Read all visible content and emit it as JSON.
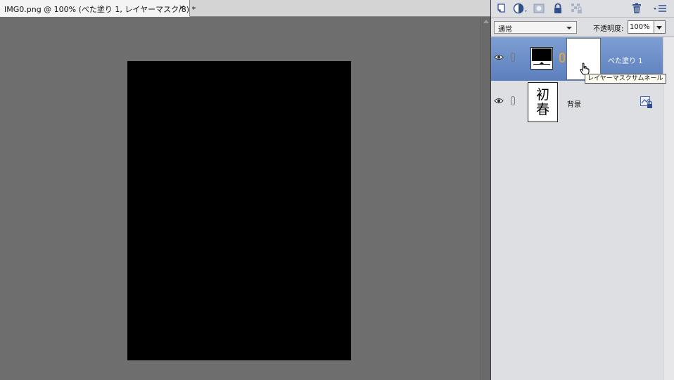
{
  "document": {
    "tab_title": "IMG0.png @ 100% (べた塗り 1, レイヤーマスク/8) *",
    "close_glyph": "×",
    "canvas_color": "#6e6e6e",
    "image_color": "#000000"
  },
  "layers_panel": {
    "toolbar_icons": [
      "new-layer-icon",
      "adjustment-layer-icon",
      "add-mask-icon",
      "lock-all-icon",
      "lock-transparency-icon",
      "trash-icon",
      "panel-menu-icon"
    ],
    "blend_mode": "通常",
    "opacity_label": "不透明度:",
    "opacity_value": "100%",
    "layers": [
      {
        "name": "べた塗り 1",
        "selected": true,
        "selected_color": "#6b8cc7"
      },
      {
        "name": "背景",
        "selected": false,
        "thumb_text_line1": "初",
        "thumb_text_line2": "春"
      }
    ],
    "tooltip": "レイヤーマスクサムネール"
  }
}
